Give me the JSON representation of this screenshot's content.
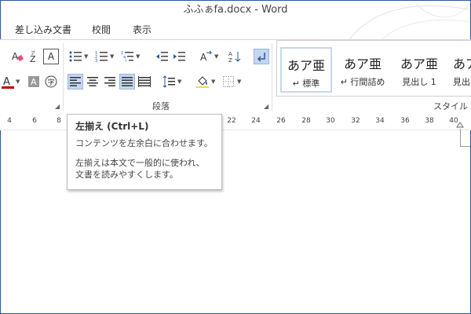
{
  "window": {
    "title": "ふふぁfa.docx - Word"
  },
  "tabs": [
    {
      "label": "差し込み文書"
    },
    {
      "label": "校閲"
    },
    {
      "label": "表示"
    }
  ],
  "ribbon": {
    "groups": {
      "paragraph_label": "段落",
      "styles_label": "スタイル"
    },
    "font_buttons": {
      "clear": "clear-format",
      "phonetic": "Z",
      "charborder": "A",
      "fontcolor": "A",
      "shade": "A",
      "enclose": "字"
    },
    "styles": [
      {
        "sample": "あア亜",
        "name": "↵ 標準"
      },
      {
        "sample": "あア亜",
        "name": "↵ 行間詰め"
      },
      {
        "sample": "あア亜",
        "name": "見出し 1"
      },
      {
        "sample": "あア亜",
        "name": "見出"
      }
    ]
  },
  "ruler": {
    "ticks": [
      "4",
      "6",
      "8",
      "22",
      "24",
      "26",
      "28",
      "30",
      "32",
      "34",
      "36",
      "38",
      "40"
    ]
  },
  "tooltip": {
    "title": "左揃え (Ctrl+L)",
    "line1": "コンテンツを左余白に合わせます。",
    "line2": "左揃えは本文で一般的に使われ、",
    "line3": "文書を読みやすくします。"
  },
  "colors": {
    "accent": "#2b579a",
    "active_bg": "#c5d7ee",
    "font_red": "#c00000"
  }
}
